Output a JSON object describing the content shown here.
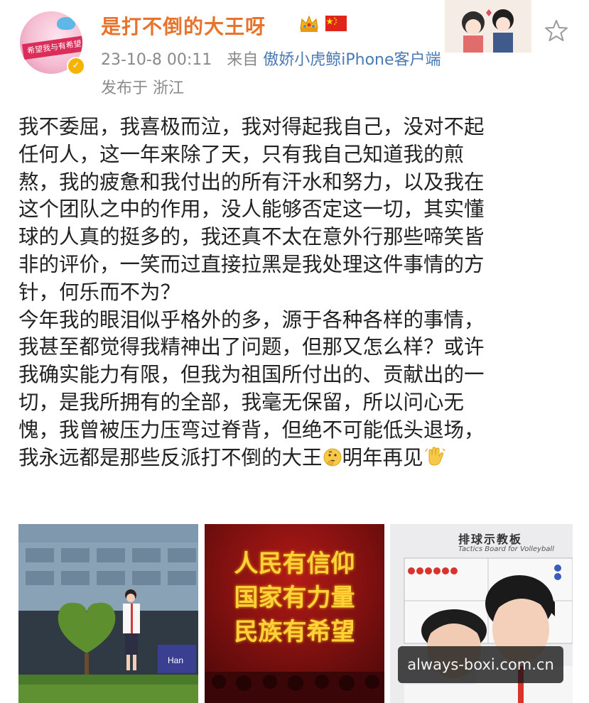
{
  "post": {
    "author": {
      "name": "是打不倒的大王呀",
      "avatar_banner_text": "希望我与有希望",
      "verified": true
    },
    "meta": {
      "timestamp": "23-10-8 00:11",
      "source_prefix": "来自",
      "source_client": "傲娇小虎鲸iPhone客户端",
      "location": "发布于 浙江"
    },
    "body_lines": [
      "我不委屈，我喜极而泣，我对得起我自己，没对不起",
      "任何人，这一年来除了天，只有我自己知道我的煎",
      "熬，我的疲惫和我付出的所有汗水和努力，以及我在",
      "这个团队之中的作用，没人能够否定这一切，其实懂",
      "球的人真的挺多的，我还真不太在意外行那些啼笑皆",
      "非的评价，一笑而过直接拉黑是我处理这件事情的方",
      "针，何乐而不为？",
      "今年我的眼泪似乎格外的多，源于各种各样的事情，",
      "我甚至都觉得我精神出了问题，但那又怎么样？或许",
      "我确实能力有限，但我为祖国所付出的、贡献出的一",
      "切，是我所拥有的全部，我毫无保留，所以问心无",
      "愧，我曾被压力压弯过脊背，但绝不可能低头退场，"
    ],
    "body_last_line": {
      "before_emoji": "我永远都是那些反派打不倒的大王",
      "after_emoji": "明年再见"
    },
    "photos": [
      {
        "caption": "",
        "sign_text": "Han"
      },
      {
        "slogan_lines": [
          "人民有信仰",
          "国家有力量",
          "民族有希望"
        ]
      },
      {
        "board_title": "排球示教板",
        "board_subtitle": "Tactics Board for Volleyball"
      }
    ]
  },
  "watermark": "always-boxi.com.cn",
  "icons": {
    "favorite": "star-outline-icon",
    "crown": "crown-emoji-icon",
    "flag": "china-flag-icon",
    "thinking": "thinking-face-emoji-icon",
    "wave": "waving-hand-emoji-icon"
  },
  "colors": {
    "username": "#e8732c",
    "meta": "#8a8a8a",
    "source_link": "#4a7ab3",
    "body_text": "#222222",
    "slogan": "#ffd23a",
    "slogan_bg": "#8b0f12"
  }
}
